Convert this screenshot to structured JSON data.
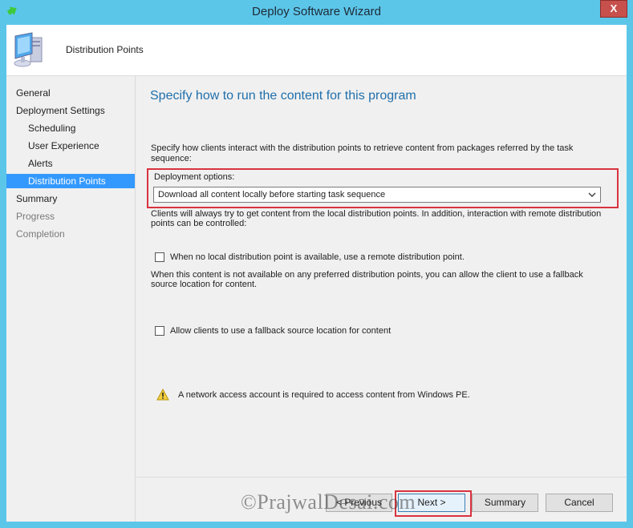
{
  "window": {
    "title": "Deploy Software Wizard",
    "close_label": "X"
  },
  "header": {
    "title": "Distribution Points"
  },
  "nav": {
    "items": [
      {
        "label": "General",
        "state": "normal"
      },
      {
        "label": "Deployment Settings",
        "state": "normal"
      },
      {
        "label": "Scheduling",
        "state": "normal"
      },
      {
        "label": "User Experience",
        "state": "normal"
      },
      {
        "label": "Alerts",
        "state": "normal"
      },
      {
        "label": "Distribution Points",
        "state": "active"
      },
      {
        "label": "Summary",
        "state": "normal"
      },
      {
        "label": "Progress",
        "state": "disabled"
      },
      {
        "label": "Completion",
        "state": "disabled"
      }
    ]
  },
  "main": {
    "heading": "Specify how to run the content for this program",
    "intro_line1": "Specify how clients interact with the distribution points to retrieve content from packages referred by the task",
    "intro_line2": "sequence:",
    "deployment_options_label": "Deployment options:",
    "deployment_options_value": "Download all content locally before starting task sequence",
    "clients_note_line1": "Clients will always try to get content from the local distribution points. In addition, interaction with remote distribution",
    "clients_note_line2": "points can be controlled:",
    "checkbox_remote_dp": {
      "label": "When no local distribution point is available, use a remote distribution point.",
      "checked": false
    },
    "fallback_note_line1": "When this content is not available on any preferred distribution points, you can allow the client to use a fallback",
    "fallback_note_line2": "source location for content.",
    "checkbox_fallback": {
      "label": "Allow clients to use a fallback source location for content",
      "checked": false
    },
    "warning_text": "A network access account is required to access content from Windows PE."
  },
  "footer": {
    "previous_label": "< Previous",
    "next_label": "Next >",
    "summary_label": "Summary",
    "cancel_label": "Cancel"
  },
  "watermark": "©PrajwalDesai.com",
  "colors": {
    "titlebar": "#5cc6e9",
    "heading": "#1f6fab",
    "nav_active": "#3399ff",
    "highlight_box": "#d9333f",
    "close_button": "#c7504d"
  }
}
